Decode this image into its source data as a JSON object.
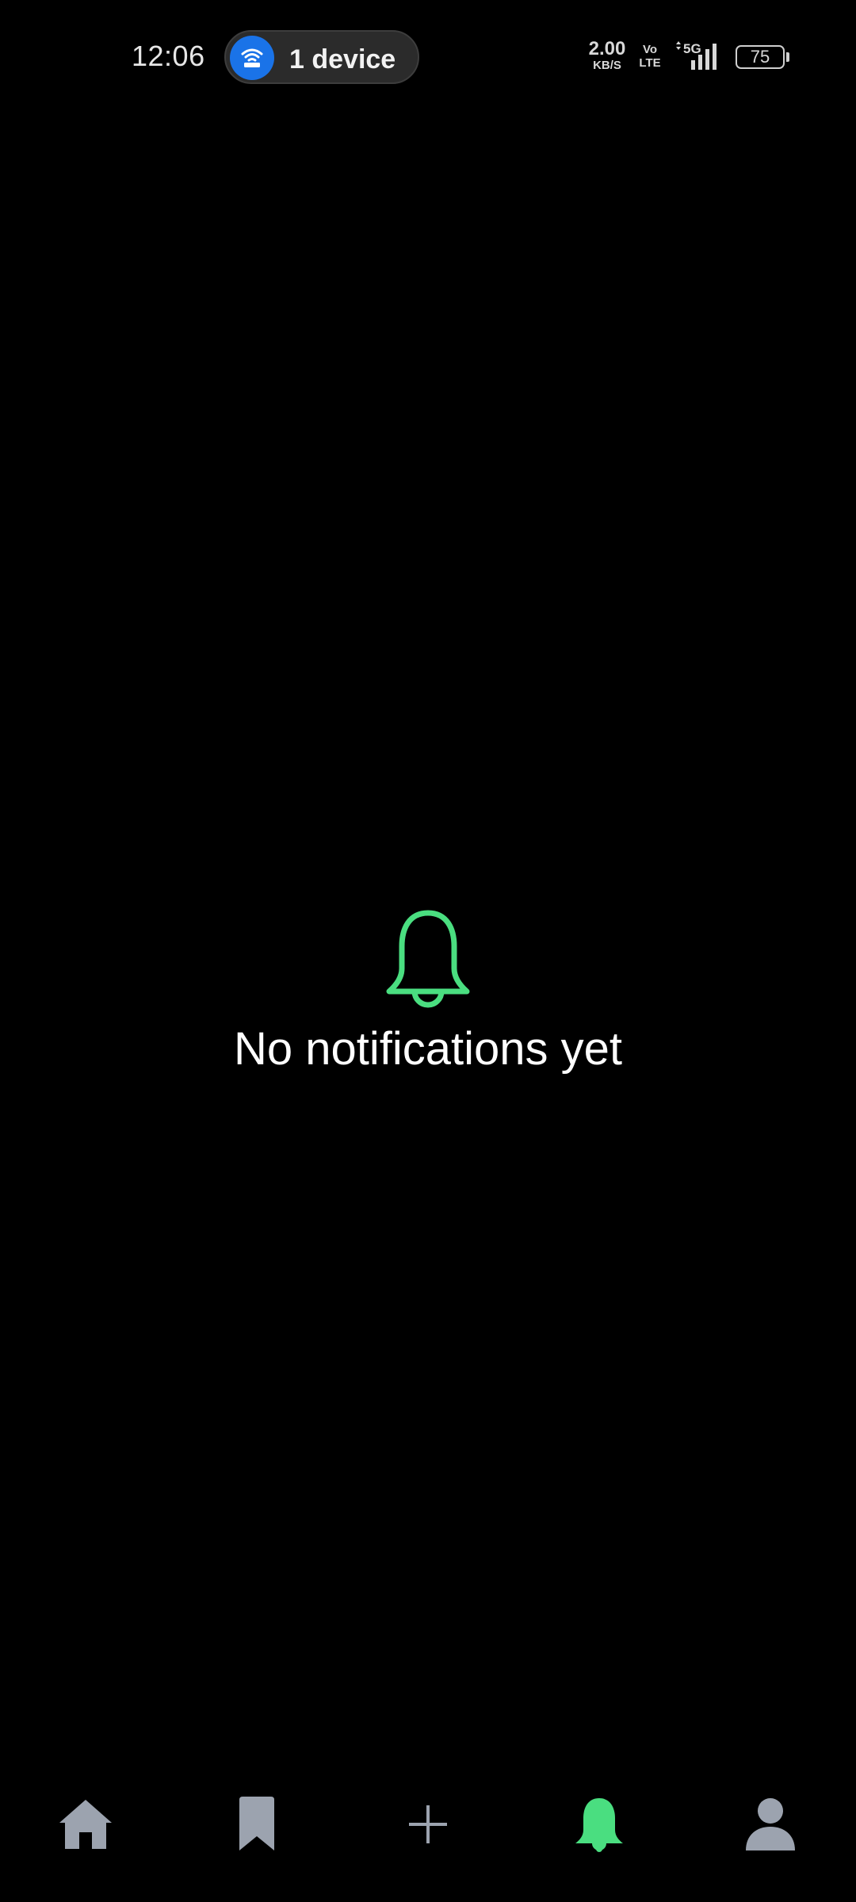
{
  "status_bar": {
    "time": "12:06",
    "hotspot_label": "1 device",
    "net_speed_value": "2.00",
    "net_speed_unit": "KB/S",
    "volte_top": "Vo",
    "volte_bottom": "LTE",
    "network_type": "5G",
    "battery_level": "75"
  },
  "empty_state": {
    "icon": "bell-icon",
    "message": "No notifications yet"
  },
  "bottom_nav": {
    "items": [
      {
        "name": "home",
        "icon": "home-icon",
        "active": false
      },
      {
        "name": "bookmarks",
        "icon": "bookmark-icon",
        "active": false
      },
      {
        "name": "create",
        "icon": "plus-icon",
        "active": false
      },
      {
        "name": "notifications",
        "icon": "bell-icon",
        "active": true
      },
      {
        "name": "profile",
        "icon": "person-icon",
        "active": false
      }
    ]
  },
  "colors": {
    "background": "#000000",
    "accent_green": "#4ade80",
    "inactive_icon": "#9ca3af",
    "hotspot_blue": "#1a73e8"
  }
}
